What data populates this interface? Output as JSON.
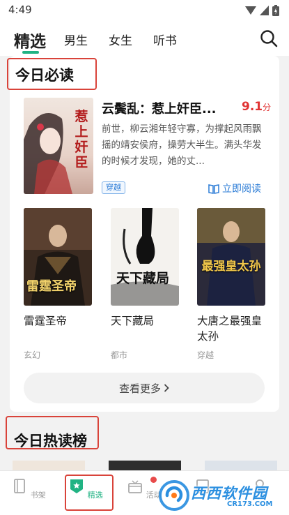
{
  "status": {
    "time": "4:49"
  },
  "nav": {
    "tabs": [
      {
        "label": "精选"
      },
      {
        "label": "男生"
      },
      {
        "label": "女生"
      },
      {
        "label": "听书"
      }
    ]
  },
  "colors": {
    "accent": "#20b383",
    "score": "#e03232",
    "link": "#2a7bd6",
    "highlight_frame": "#d9433a"
  },
  "today": {
    "title": "今日必读",
    "feature": {
      "cover_text": "惹上奸臣",
      "title": "云鬓乱：惹上奸臣...",
      "score": "9.1",
      "score_unit": "分",
      "desc": "前世，柳云湘年轻守寡，为撑起风雨飘摇的靖安侯府，操劳大半生。满头华发的时候才发现，她的丈...",
      "tag": "穿越",
      "read_label": "立即阅读"
    },
    "books": [
      {
        "cover_text": "雷霆圣帝",
        "title": "雷霆圣帝",
        "category": "玄幻"
      },
      {
        "cover_text": "天下藏局",
        "title": "天下藏局",
        "category": "都市"
      },
      {
        "cover_text": "最强皇太孙",
        "title": "大唐之最强皇太孙",
        "category": "穿越"
      }
    ],
    "more_label": "查看更多"
  },
  "hot": {
    "title": "今日热读榜"
  },
  "bottom_nav": [
    {
      "label": "书架",
      "icon": "bookshelf-icon"
    },
    {
      "label": "精选",
      "icon": "featured-shield-icon"
    },
    {
      "label": "活动",
      "icon": "gift-icon"
    },
    {
      "label": "",
      "icon": "category-icon"
    },
    {
      "label": "",
      "icon": "profile-icon"
    }
  ],
  "watermark": {
    "brand": "西西软件园",
    "domain": "CR173.COM"
  }
}
